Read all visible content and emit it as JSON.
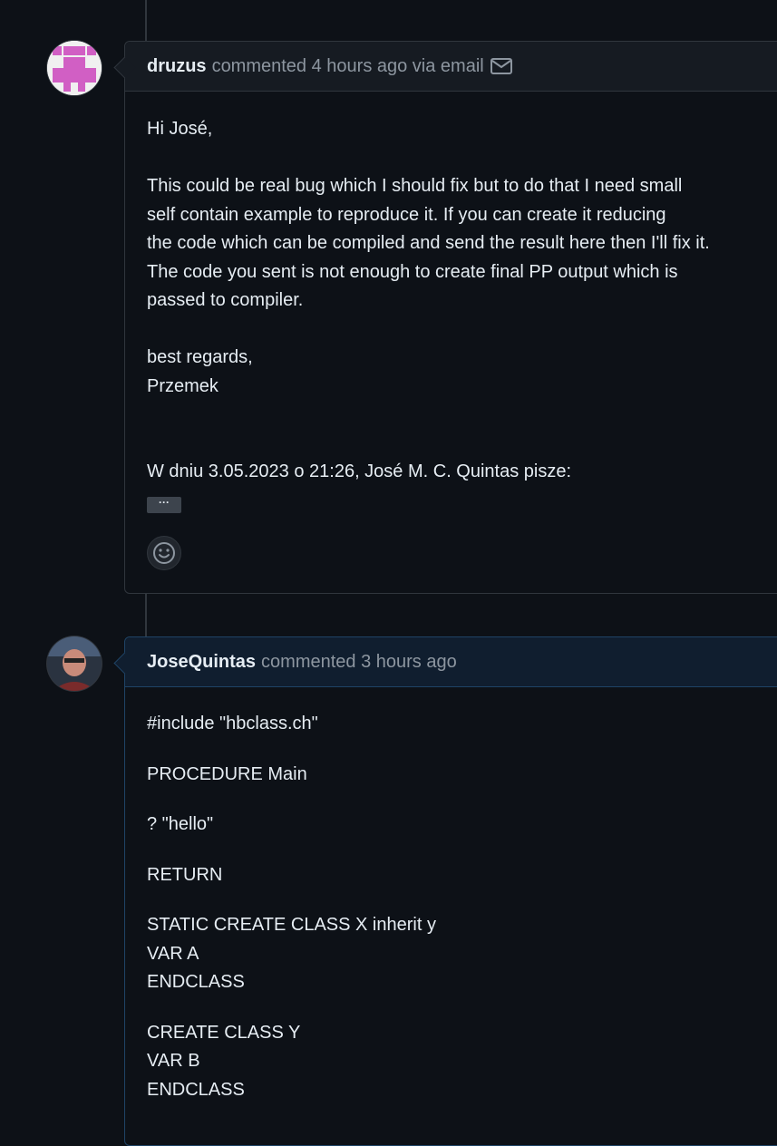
{
  "comments": [
    {
      "author": "druzus",
      "meta": "commented 4 hours ago via email",
      "avatar_icon": "identicon-pink",
      "greeting": "Hi José,",
      "paragraph": [
        "This could be real bug which I should fix but to do that I need small",
        "self contain example to reproduce it. If you can create it reducing",
        "the code which can be compiled and send the result here then I'll fix it.",
        "The code you sent is not enough to create final PP output which is",
        "passed to compiler."
      ],
      "signoff": [
        "best regards,",
        "Przemek"
      ],
      "quote_line": "W dniu 3.05.2023 o 21:26, José M. C. Quintas pisze:",
      "expand_label": "···",
      "reaction_icon": "smiley-icon"
    },
    {
      "author": "JoseQuintas",
      "meta": "commented 3 hours ago",
      "avatar_icon": "user-photo",
      "code": [
        [
          "#include \"hbclass.ch\""
        ],
        [
          "PROCEDURE Main"
        ],
        [
          "? \"hello\""
        ],
        [
          "RETURN"
        ],
        [
          "STATIC CREATE CLASS X inherit y",
          "VAR A",
          "ENDCLASS"
        ],
        [
          "CREATE CLASS Y",
          "VAR B",
          "ENDCLASS"
        ]
      ]
    }
  ],
  "colors": {
    "background": "#0d1117",
    "border": "#30363d",
    "own_border": "#1f4466",
    "text": "#e6edf3",
    "muted": "#8d96a0",
    "identicon": "#d15fc4"
  }
}
